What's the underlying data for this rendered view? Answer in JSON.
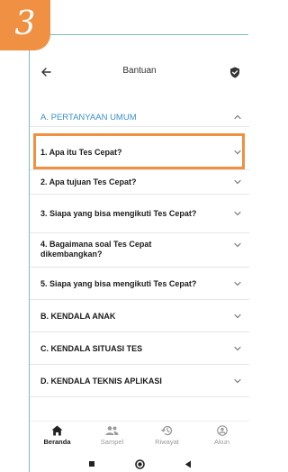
{
  "badge": {
    "number": "3"
  },
  "appbar": {
    "title": "Bantuan"
  },
  "section_a": {
    "label": "A. PERTANYAAN UMUM"
  },
  "questions": [
    {
      "label": "1. Apa itu Tes Cepat?"
    },
    {
      "label": "2. Apa tujuan Tes Cepat?"
    },
    {
      "label": "3. Siapa yang bisa mengikuti Tes Cepat?"
    },
    {
      "label": "4. Bagaimana soal Tes Cepat dikembangkan?"
    },
    {
      "label": "5. Siapa yang bisa mengikuti Tes Cepat?"
    }
  ],
  "sections": [
    {
      "label": "B. KENDALA ANAK"
    },
    {
      "label": "C. KENDALA SITUASI TES"
    },
    {
      "label": "D. KENDALA TEKNIS APLIKASI"
    }
  ],
  "bottom_nav": {
    "items": [
      {
        "label": "Beranda",
        "icon": "home-icon",
        "active": true
      },
      {
        "label": "Sampel",
        "icon": "people-icon",
        "active": false
      },
      {
        "label": "Riwayat",
        "icon": "history-icon",
        "active": false
      },
      {
        "label": "Akun",
        "icon": "account-icon",
        "active": false
      }
    ]
  },
  "colors": {
    "accent": "#ef9042",
    "section_blue": "#3b8fd0",
    "frame_teal": "#7fbcbc"
  }
}
